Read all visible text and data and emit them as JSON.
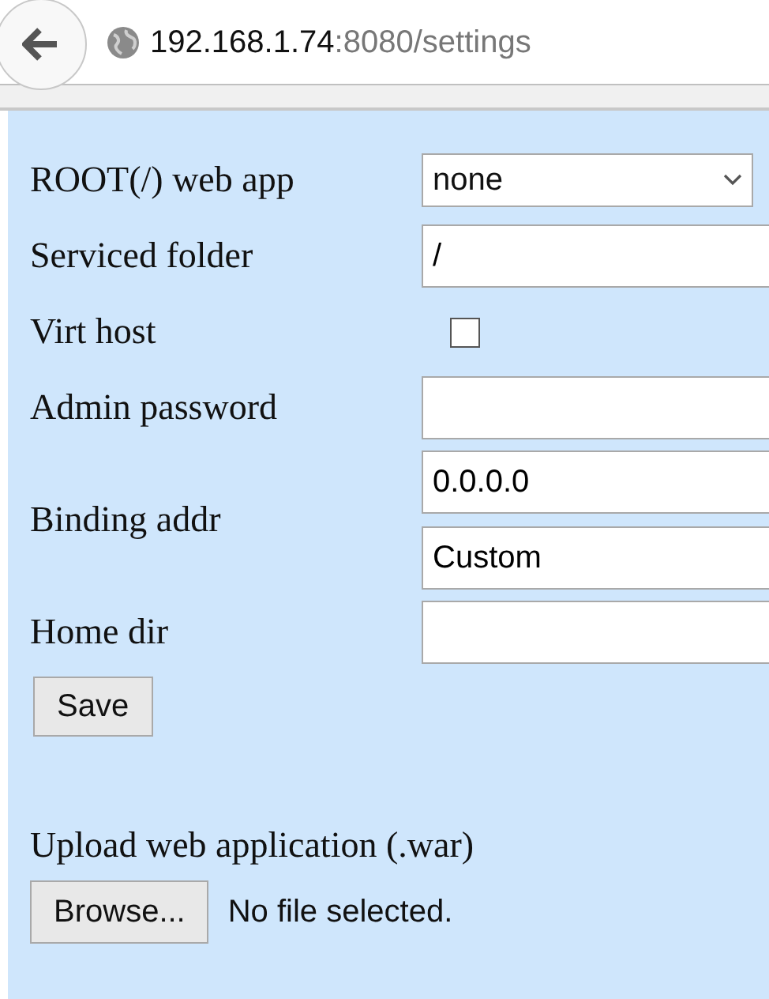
{
  "address_bar": {
    "host": "192.168.1.74",
    "path": ":8080/settings"
  },
  "form": {
    "rows": [
      {
        "kind": "select",
        "label": "ROOT(/) web app",
        "value": "none"
      },
      {
        "kind": "text",
        "label": "Serviced folder",
        "value": "/"
      },
      {
        "kind": "checkbox",
        "label": "Virt host",
        "checked": false
      },
      {
        "kind": "text",
        "label": "Admin password",
        "value": ""
      },
      {
        "kind": "pair",
        "label": "Binding addr",
        "values": [
          "0.0.0.0",
          "Custom"
        ]
      },
      {
        "kind": "text",
        "label": "Home dir",
        "value": ""
      }
    ],
    "save_button": "Save"
  },
  "upload": {
    "title": "Upload web application (.war)",
    "browse_button": "Browse...",
    "status": "No file selected."
  }
}
